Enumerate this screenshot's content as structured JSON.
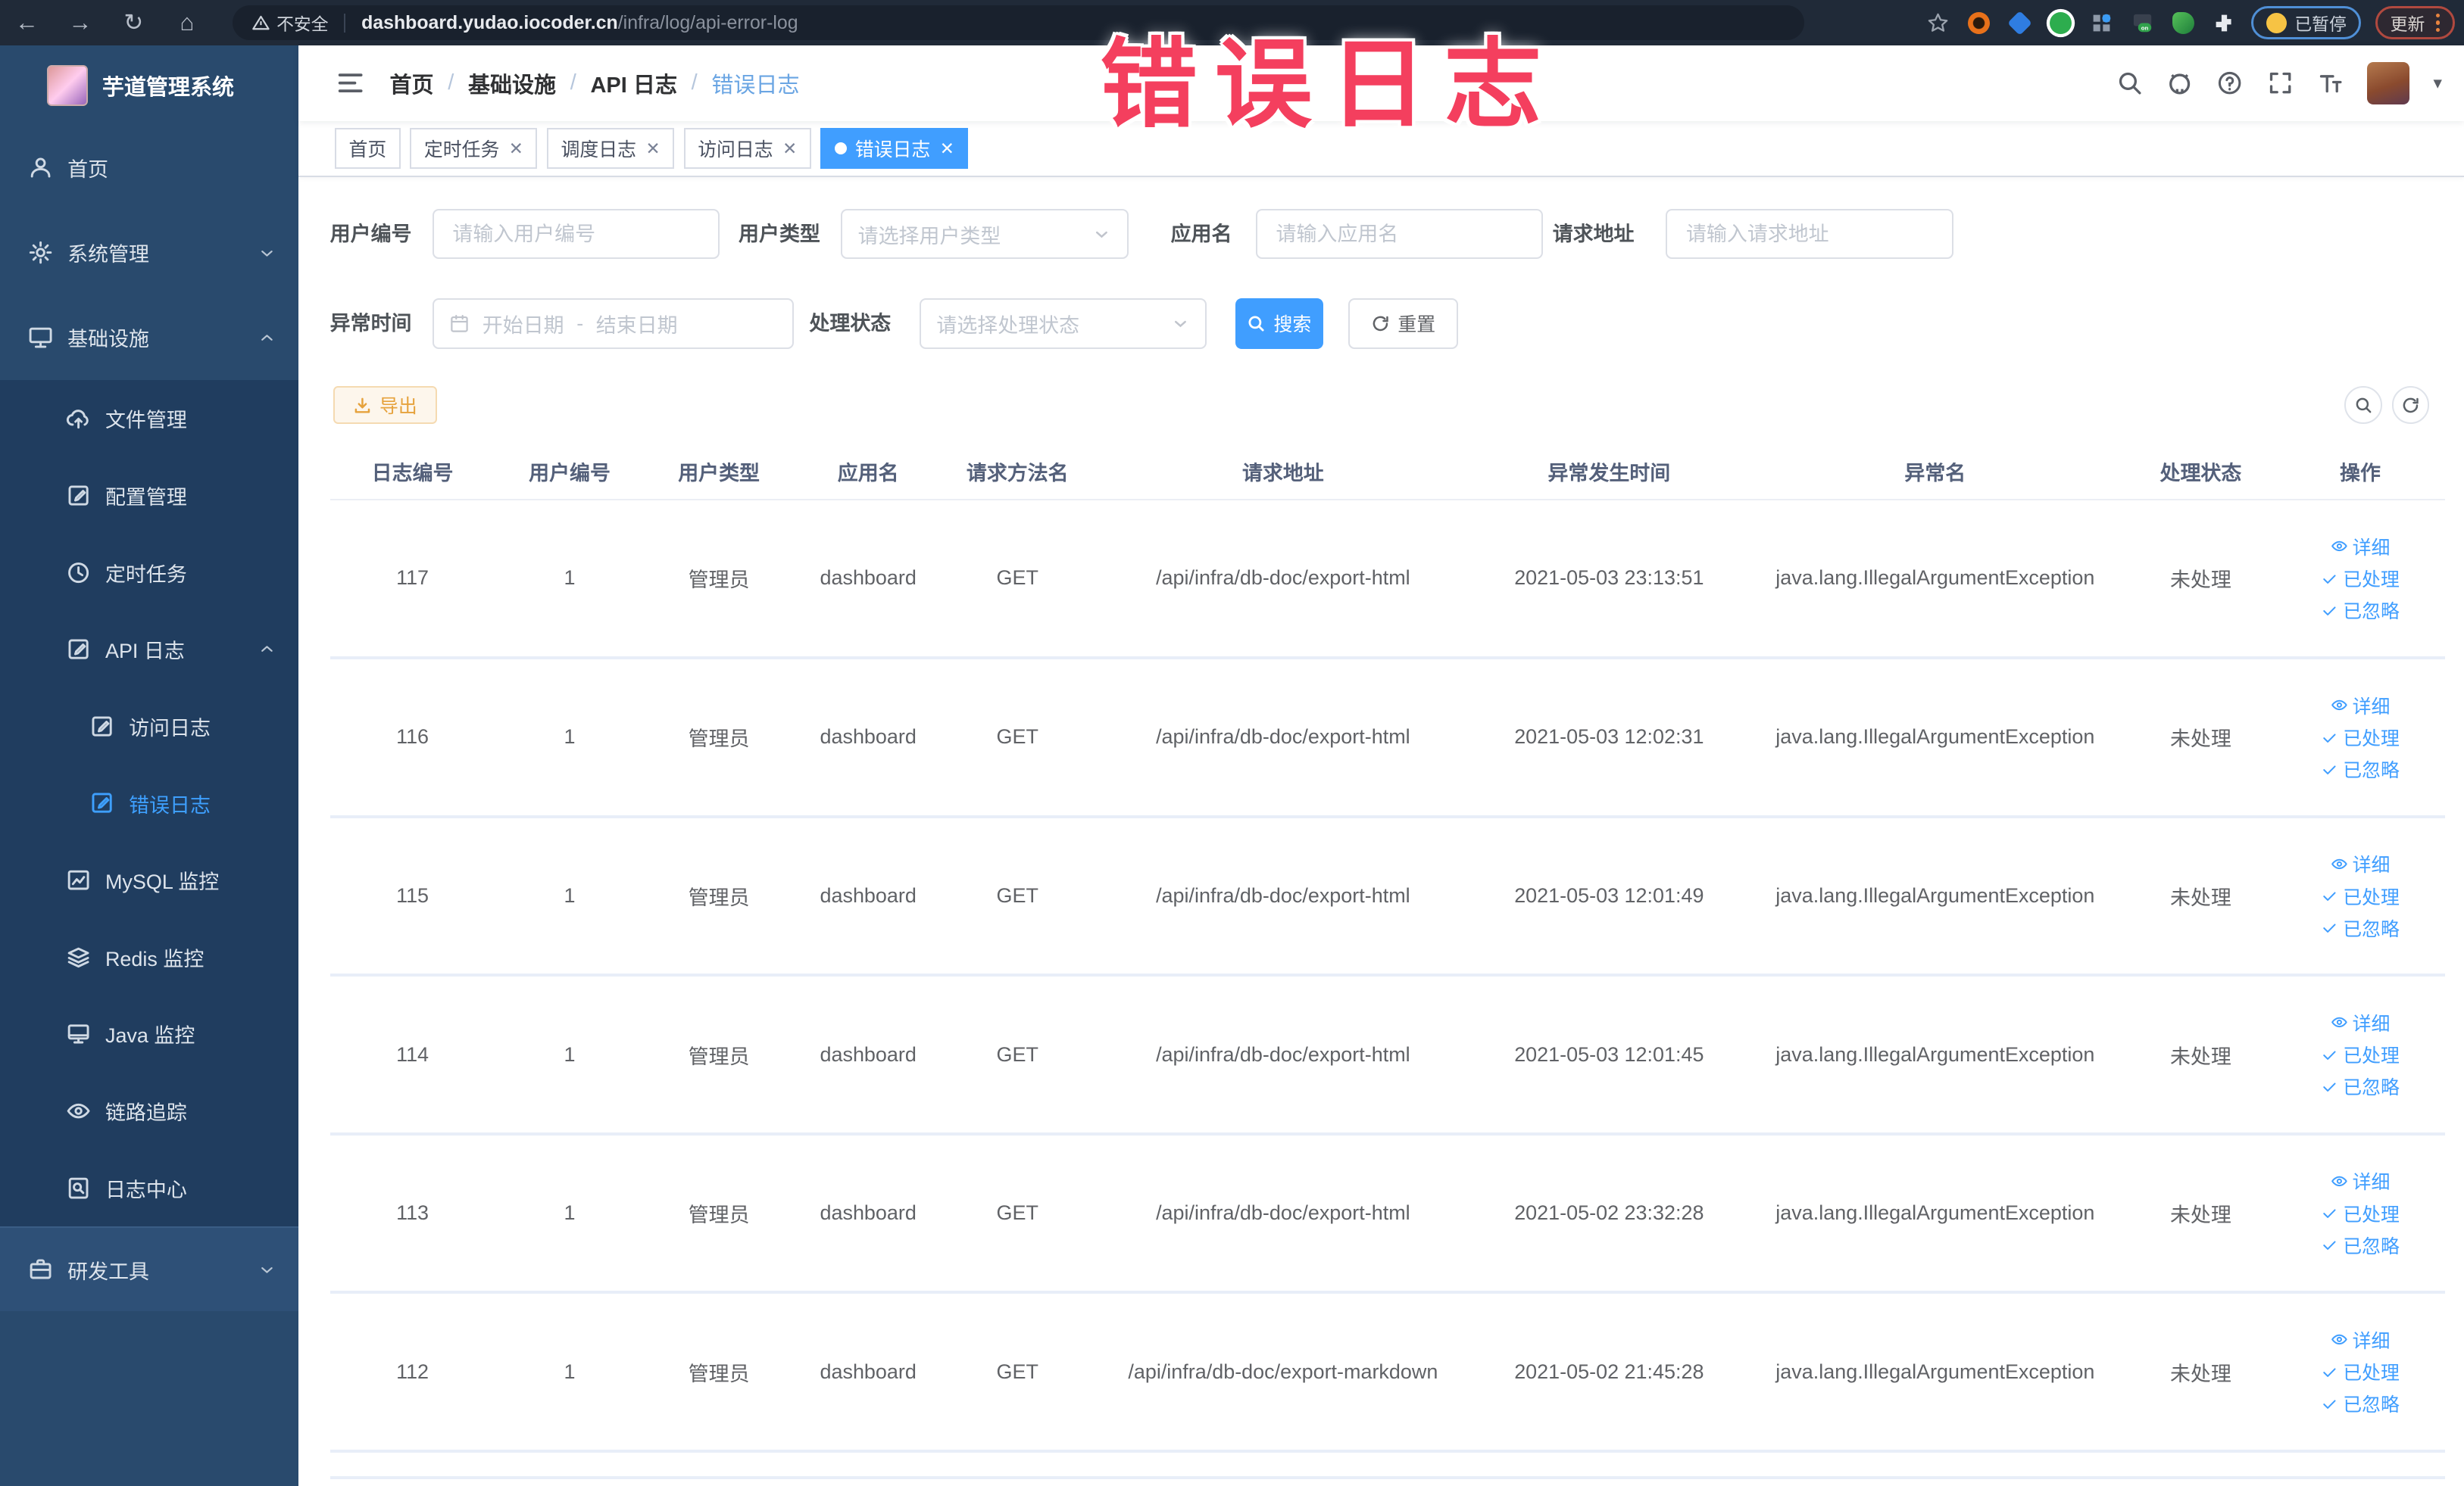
{
  "overlay": {
    "text": "错误日志",
    "color": "#f43f5e"
  },
  "browser": {
    "security_label": "不安全",
    "url_host": "dashboard.yudao.iocoder.cn",
    "url_path": "/infra/log/api-error-log",
    "paused_label": "已暂停",
    "update_label": "更新"
  },
  "sidebar": {
    "title": "芋道管理系统",
    "items": [
      {
        "label": "首页",
        "icon": "user",
        "level": 1
      },
      {
        "label": "系统管理",
        "icon": "gear",
        "level": 1,
        "arrow": "down"
      },
      {
        "label": "基础设施",
        "icon": "monitor",
        "level": 1,
        "arrow": "up"
      },
      {
        "label": "文件管理",
        "icon": "cloud-up",
        "level": 2
      },
      {
        "label": "配置管理",
        "icon": "edit-doc",
        "level": 2
      },
      {
        "label": "定时任务",
        "icon": "history",
        "level": 2
      },
      {
        "label": "API 日志",
        "icon": "edit-doc",
        "level": 2,
        "arrow": "up"
      },
      {
        "label": "访问日志",
        "icon": "edit-doc",
        "level": 3
      },
      {
        "label": "错误日志",
        "icon": "edit-doc",
        "level": 3,
        "active": true
      },
      {
        "label": "MySQL 监控",
        "icon": "chart",
        "level": 2
      },
      {
        "label": "Redis 监控",
        "icon": "layers",
        "level": 2
      },
      {
        "label": "Java 监控",
        "icon": "screen",
        "level": 2
      },
      {
        "label": "链路追踪",
        "icon": "eye",
        "level": 2
      },
      {
        "label": "日志中心",
        "icon": "doc-search",
        "level": 2
      },
      {
        "label": "研发工具",
        "icon": "toolbox",
        "level": 1,
        "arrow": "down",
        "light": true
      }
    ]
  },
  "header": {
    "breadcrumb": [
      "首页",
      "基础设施",
      "API 日志",
      "错误日志"
    ]
  },
  "tabs": [
    {
      "label": "首页",
      "closable": false,
      "active": false
    },
    {
      "label": "定时任务",
      "closable": true,
      "active": false
    },
    {
      "label": "调度日志",
      "closable": true,
      "active": false
    },
    {
      "label": "访问日志",
      "closable": true,
      "active": false
    },
    {
      "label": "错误日志",
      "closable": true,
      "active": true
    }
  ],
  "filters": {
    "user_id": {
      "label": "用户编号",
      "placeholder": "请输入用户编号"
    },
    "user_type": {
      "label": "用户类型",
      "placeholder": "请选择用户类型"
    },
    "app_name": {
      "label": "应用名",
      "placeholder": "请输入应用名"
    },
    "request_url": {
      "label": "请求地址",
      "placeholder": "请输入请求地址"
    },
    "exception_time": {
      "label": "异常时间",
      "start_placeholder": "开始日期",
      "separator": "-",
      "end_placeholder": "结束日期"
    },
    "process_status": {
      "label": "处理状态",
      "placeholder": "请选择处理状态"
    },
    "search_label": "搜索",
    "reset_label": "重置"
  },
  "toolbar": {
    "export_label": "导出"
  },
  "table": {
    "columns": [
      "日志编号",
      "用户编号",
      "用户类型",
      "应用名",
      "请求方法名",
      "请求地址",
      "异常发生时间",
      "异常名",
      "处理状态",
      "操作"
    ],
    "actions": [
      {
        "label": "详细",
        "icon": "eye"
      },
      {
        "label": "已处理",
        "icon": "check"
      },
      {
        "label": "已忽略",
        "icon": "check"
      }
    ],
    "rows": [
      {
        "id": "117",
        "user_id": "1",
        "user_type": "管理员",
        "app": "dashboard",
        "method": "GET",
        "url": "/api/infra/db-doc/export-html",
        "time": "2021-05-03 23:13:51",
        "exception": "java.lang.IllegalArgumentException",
        "status": "未处理"
      },
      {
        "id": "116",
        "user_id": "1",
        "user_type": "管理员",
        "app": "dashboard",
        "method": "GET",
        "url": "/api/infra/db-doc/export-html",
        "time": "2021-05-03 12:02:31",
        "exception": "java.lang.IllegalArgumentException",
        "status": "未处理"
      },
      {
        "id": "115",
        "user_id": "1",
        "user_type": "管理员",
        "app": "dashboard",
        "method": "GET",
        "url": "/api/infra/db-doc/export-html",
        "time": "2021-05-03 12:01:49",
        "exception": "java.lang.IllegalArgumentException",
        "status": "未处理"
      },
      {
        "id": "114",
        "user_id": "1",
        "user_type": "管理员",
        "app": "dashboard",
        "method": "GET",
        "url": "/api/infra/db-doc/export-html",
        "time": "2021-05-03 12:01:45",
        "exception": "java.lang.IllegalArgumentException",
        "status": "未处理"
      },
      {
        "id": "113",
        "user_id": "1",
        "user_type": "管理员",
        "app": "dashboard",
        "method": "GET",
        "url": "/api/infra/db-doc/export-html",
        "time": "2021-05-02 23:32:28",
        "exception": "java.lang.IllegalArgumentException",
        "status": "未处理"
      },
      {
        "id": "112",
        "user_id": "1",
        "user_type": "管理员",
        "app": "dashboard",
        "method": "GET",
        "url": "/api/infra/db-doc/export-markdown",
        "time": "2021-05-02 21:45:28",
        "exception": "java.lang.IllegalArgumentException",
        "status": "未处理"
      }
    ]
  },
  "colors": {
    "accent": "#409eff",
    "warning": "#e6a23c",
    "sidebar": "#294a6d",
    "sidebar_submenu": "#203d5f",
    "overlay_red": "#f43f5e",
    "chrome_bar": "#202a38"
  }
}
